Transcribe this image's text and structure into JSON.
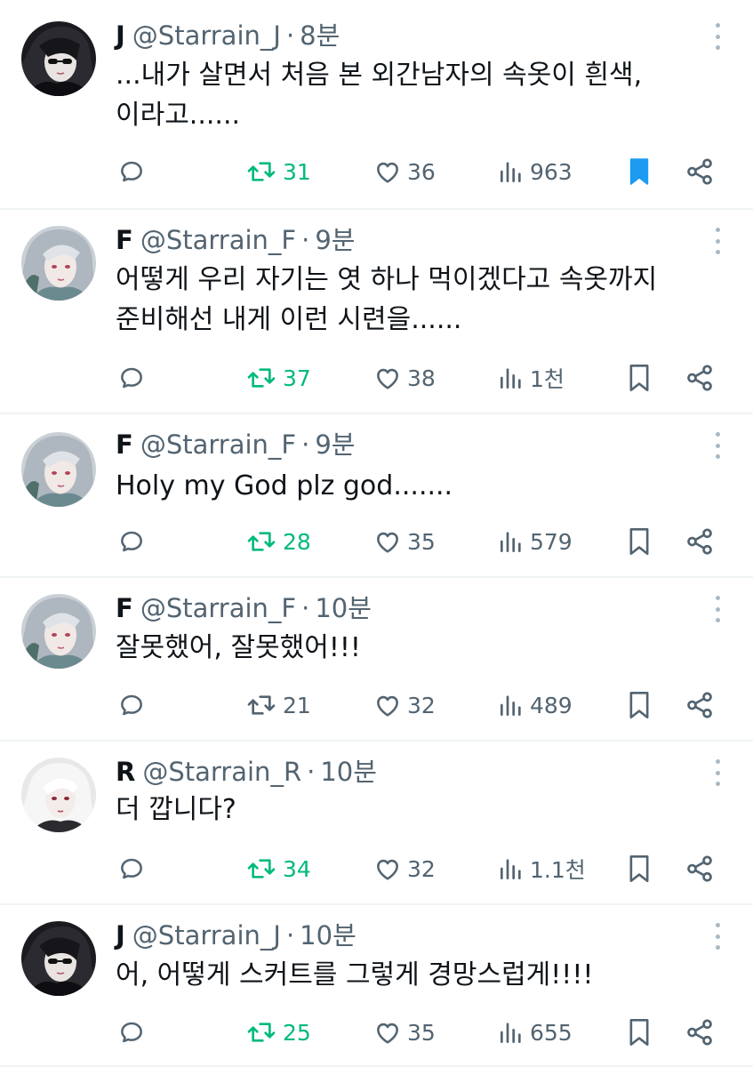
{
  "tweets": [
    {
      "name": "J",
      "handle": "@Starrain_J",
      "sep": "·",
      "time": "8분",
      "avatar": "avatar-j",
      "text": "...내가 살면서 처음 본 외간남자의 속옷이 흰색,\n이라고......",
      "retweets": "31",
      "retweeted": true,
      "likes": "36",
      "views": "963",
      "bookmarked": true
    },
    {
      "name": "F",
      "handle": "@Starrain_F",
      "sep": "·",
      "time": "9분",
      "avatar": "avatar-f",
      "text": "어떻게 우리 자기는 엿 하나 먹이겠다고 속옷까지\n준비해선 내게 이런 시련을......",
      "retweets": "37",
      "retweeted": true,
      "likes": "38",
      "views": "1천",
      "bookmarked": false
    },
    {
      "name": "F",
      "handle": "@Starrain_F",
      "sep": "·",
      "time": "9분",
      "avatar": "avatar-f",
      "text": "Holy my God plz god.......",
      "retweets": "28",
      "retweeted": true,
      "likes": "35",
      "views": "579",
      "bookmarked": false
    },
    {
      "name": "F",
      "handle": "@Starrain_F",
      "sep": "·",
      "time": "10분",
      "avatar": "avatar-f",
      "text": "잘못했어, 잘못했어!!!",
      "retweets": "21",
      "retweeted": false,
      "likes": "32",
      "views": "489",
      "bookmarked": false
    },
    {
      "name": "R",
      "handle": "@Starrain_R",
      "sep": "·",
      "time": "10분",
      "avatar": "avatar-r",
      "text": "더 깝니다?",
      "retweets": "34",
      "retweeted": true,
      "likes": "32",
      "views": "1.1천",
      "bookmarked": false
    },
    {
      "name": "J",
      "handle": "@Starrain_J",
      "sep": "·",
      "time": "10분",
      "avatar": "avatar-j",
      "text": "어, 어떻게 스커트를 그렇게 경망스럽게!!!!",
      "retweets": "25",
      "retweeted": true,
      "likes": "35",
      "views": "655",
      "bookmarked": false
    }
  ],
  "icons": {
    "reply": "reply-icon",
    "retweet": "retweet-icon",
    "like": "heart-icon",
    "views": "views-icon",
    "bookmark": "bookmark-icon",
    "share": "share-icon",
    "more": "more-icon"
  },
  "colors": {
    "retweet_active": "#00ba7c",
    "bookmark_active": "#1d9bf0",
    "muted": "#536471",
    "text": "#0f1419",
    "divider": "#eff3f4"
  }
}
